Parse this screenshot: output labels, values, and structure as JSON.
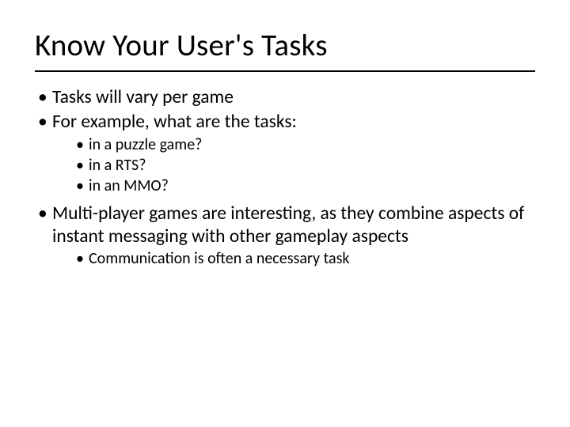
{
  "slide": {
    "title": "Know Your User's Tasks",
    "bullets": [
      {
        "text": "Tasks will vary per game",
        "children": []
      },
      {
        "text": "For example, what are the tasks:",
        "children": [
          {
            "text": "in a puzzle game?"
          },
          {
            "text": "in a RTS?"
          },
          {
            "text": "in an MMO?"
          }
        ]
      },
      {
        "text": "Multi-player games are interesting, as they combine aspects of instant messaging with other gameplay aspects",
        "children": [
          {
            "text": "Communication is often a necessary task"
          }
        ]
      }
    ]
  }
}
